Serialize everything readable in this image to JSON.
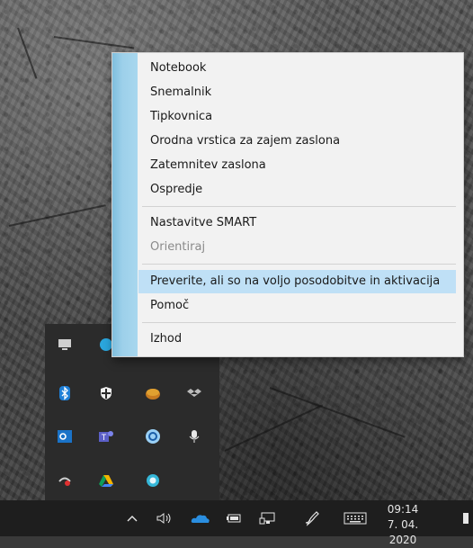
{
  "menu": {
    "items": [
      {
        "label": "Notebook"
      },
      {
        "label": "Snemalnik"
      },
      {
        "label": "Tipkovnica"
      },
      {
        "label": "Orodna vrstica za zajem zaslona"
      },
      {
        "label": "Zatemnitev zaslona"
      },
      {
        "label": "Ospredje"
      },
      {
        "label": "Nastavitve SMART"
      },
      {
        "label": "Orientiraj"
      },
      {
        "label": "Preverite, ali so na voljo posodobitve in aktivacija"
      },
      {
        "label": "Pomoč"
      },
      {
        "label": "Izhod"
      }
    ]
  },
  "tray_icons": [
    "monitor-icon",
    "edge-icon",
    "bluetooth-icon",
    "defender-icon",
    "smart-board-icon",
    "dropbox-icon",
    "outlook-icon",
    "teams-icon",
    "sync-icon",
    "microphone-icon",
    "switch-icon",
    "drive-icon",
    "circle-app-icon"
  ],
  "taskbar": {
    "time": "09:14",
    "date": "7. 04. 2020",
    "icons": [
      "chevron-up-icon",
      "volume-icon",
      "onedrive-icon",
      "battery-icon",
      "network-icon",
      "pen-icon",
      "keyboard-icon"
    ]
  },
  "colors": {
    "highlight": "#bfe0f6",
    "banner": "#9dd0ea",
    "taskbar": "#1e1e1e",
    "tray": "#2b2b2b"
  }
}
